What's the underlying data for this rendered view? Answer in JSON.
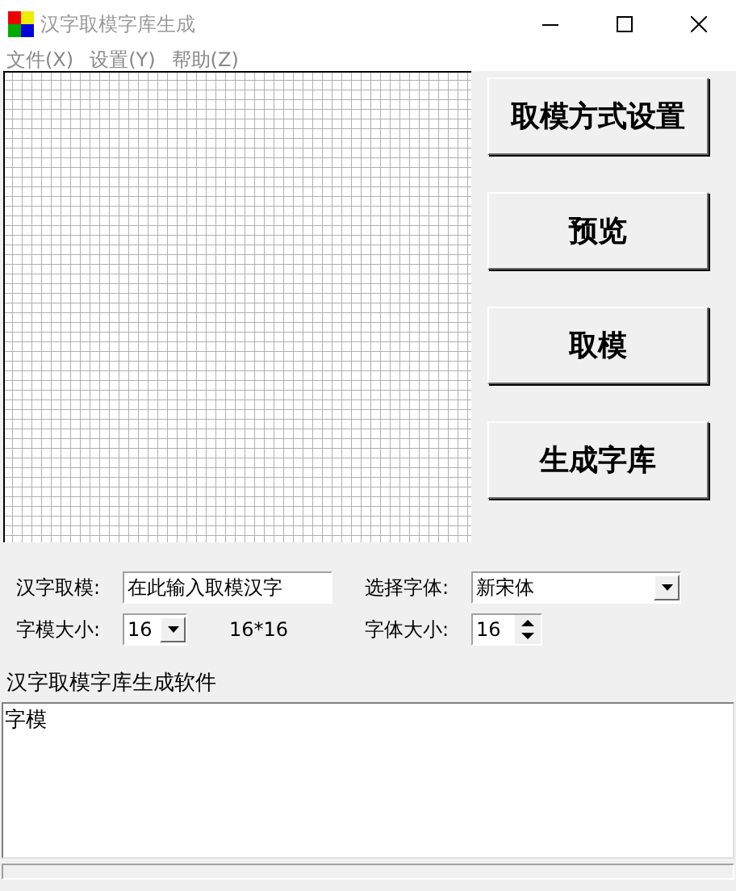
{
  "window": {
    "title": "汉字取模字库生成"
  },
  "menu": [
    "文件(X)",
    "设置(Y)",
    "帮助(Z)"
  ],
  "buttons": [
    "取模方式设置",
    "预览",
    "取模",
    "生成字库"
  ],
  "form": {
    "char_label": "汉字取模:",
    "char_value": "在此输入取模汉字",
    "font_label": "选择字体:",
    "font_value": "新宋体",
    "size_label": "字模大小:",
    "size_value": "16",
    "size_text": "16*16",
    "font_size_label": "字体大小:",
    "font_size_value": "16"
  },
  "output_label": "汉字取模字库生成软件",
  "output_text": "字模"
}
